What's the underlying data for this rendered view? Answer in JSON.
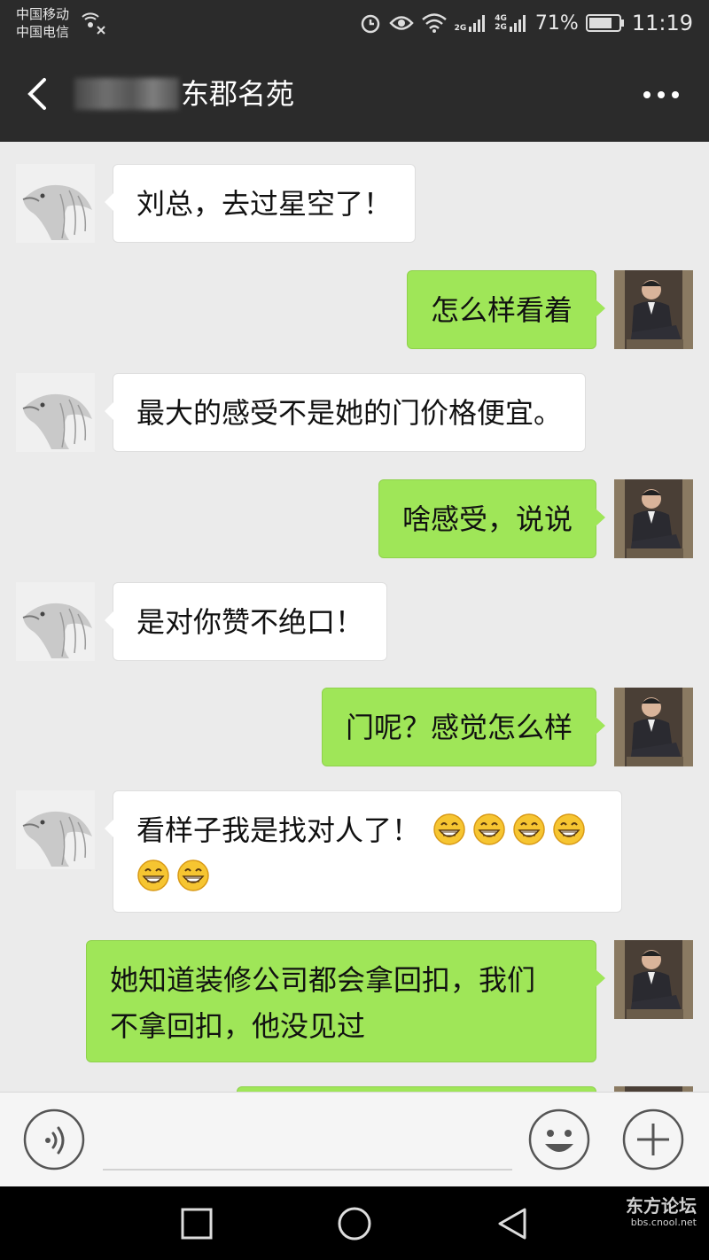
{
  "status_bar": {
    "carrier_1": "中国移动",
    "carrier_2": "中国电信",
    "network_top": "2G",
    "network_4g": "4G",
    "network_2g": "2G",
    "battery": "71%",
    "time": "11:19"
  },
  "header": {
    "title": "东郡名苑"
  },
  "messages": [
    {
      "side": "in",
      "text": "刘总，去过星空了！"
    },
    {
      "side": "out",
      "text": "怎么样看着"
    },
    {
      "side": "in",
      "text": "最大的感受不是她的门价格便宜。"
    },
    {
      "side": "out",
      "text": "啥感受，说说"
    },
    {
      "side": "in",
      "text": "是对你赞不绝口！"
    },
    {
      "side": "out",
      "text": "门呢？感觉怎么样"
    },
    {
      "side": "in",
      "text": "看样子我是找对人了！",
      "emoji": "grin-emoji",
      "emoji_count": 6
    },
    {
      "side": "out",
      "line_1": "她知道装修公司都会拿回扣，我们",
      "line_2": "不拿回扣，他没见过"
    }
  ],
  "icons": {
    "back": "back-arrow-icon",
    "more": "more-dots-icon",
    "voice": "voice-icon",
    "emoji": "emoji-icon",
    "plus": "plus-icon",
    "nav_recent": "square-icon",
    "nav_home": "circle-icon",
    "nav_back": "triangle-icon"
  },
  "colors": {
    "title_bar": "#2b2b2b",
    "chat_bg": "#ebebeb",
    "outgoing_bubble": "#9fe658",
    "incoming_bubble": "#ffffff"
  },
  "watermark": {
    "logo": "东方论坛",
    "url": "bbs.cnool.net"
  }
}
